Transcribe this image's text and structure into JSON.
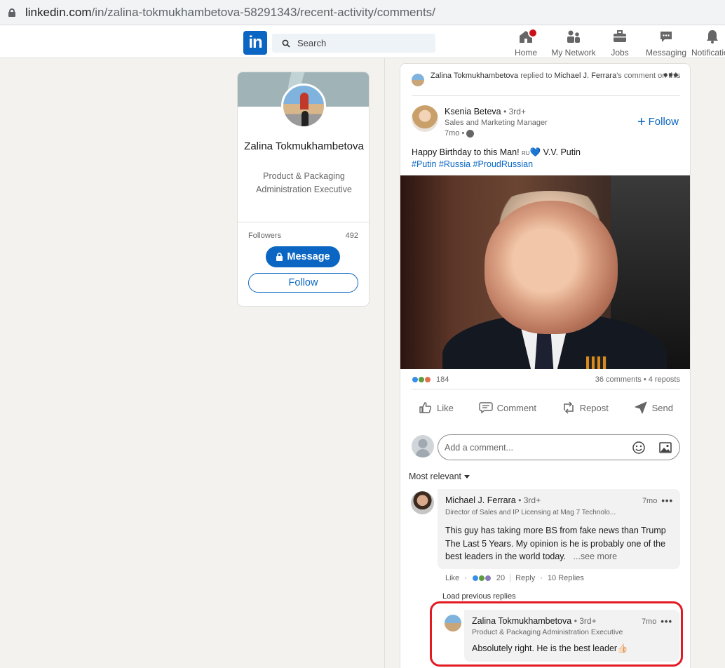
{
  "browser": {
    "url_host": "linkedin.com",
    "url_path": "/in/zalina-tokmukhambetova-58291343/recent-activity/comments/"
  },
  "nav": {
    "logo": "in",
    "search_placeholder": "Search",
    "items": [
      {
        "label": "Home",
        "icon": "home-icon"
      },
      {
        "label": "My Network",
        "icon": "network-icon"
      },
      {
        "label": "Jobs",
        "icon": "briefcase-icon"
      },
      {
        "label": "Messaging",
        "icon": "messaging-icon"
      },
      {
        "label": "Notificatio",
        "icon": "bell-icon"
      }
    ]
  },
  "profile": {
    "name": "Zalina Tokmukhambetova",
    "headline": "Product & Packaging Administration Executive",
    "followers_label": "Followers",
    "followers_count": "492",
    "message_label": "Message",
    "follow_label": "Follow"
  },
  "post": {
    "context": {
      "actor": "Zalina Tokmukhambetova",
      "verb": "replied to",
      "target": "Michael J. Ferrara",
      "suffix": "'s comment on this"
    },
    "author": {
      "name": "Ksenia Beteva",
      "degree": "• 3rd+",
      "headline": "Sales and Marketing Manager",
      "time": "7mo •"
    },
    "follow_label": "Follow",
    "text": "Happy Birthday to this Man!",
    "flag": "RU",
    "text_tail": "V.V. Putin",
    "hashtags": "#Putin #Russia #ProudRussian",
    "reactions_count": "184",
    "comments_reposts": "36 comments • 4 reposts",
    "actions": {
      "like": "Like",
      "comment": "Comment",
      "repost": "Repost",
      "send": "Send"
    },
    "comment_placeholder": "Add a comment...",
    "sort_label": "Most relevant"
  },
  "comments": [
    {
      "name": "Michael J. Ferrara",
      "degree": "• 3rd+",
      "headline": "Director of Sales and IP Licensing at Mag 7 Technolo...",
      "time": "7mo",
      "text": "This guy has taking more BS from fake news than Trump The Last 5 Years. My opinion is he is probably one of the best leaders in the world today.",
      "see_more": "...see more",
      "like_label": "Like",
      "like_count": "20",
      "reply_label": "Reply",
      "replies": "10 Replies"
    }
  ],
  "load_previous": "Load previous replies",
  "reply": {
    "name": "Zalina Tokmukhambetova",
    "degree": "• 3rd+",
    "headline": "Product & Packaging Administration Executive",
    "time": "7mo",
    "text": "Absolutely right. He is the best leader",
    "emoji": "👍🏻"
  },
  "colors": {
    "brand": "#0a66c2",
    "highlight": "#e21b23",
    "background": "#f3f2ef"
  }
}
